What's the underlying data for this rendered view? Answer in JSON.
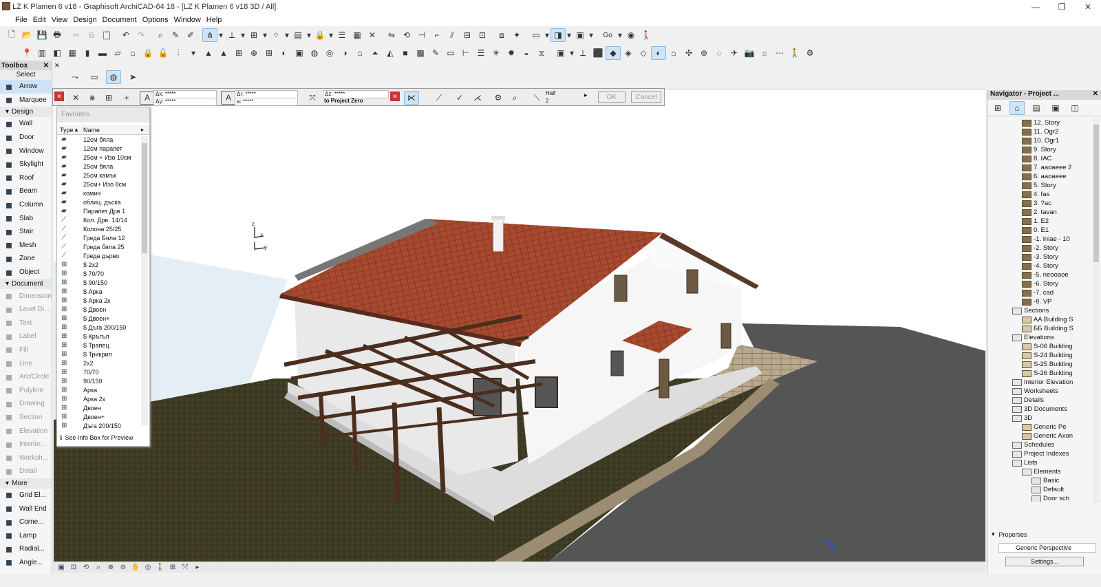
{
  "window": {
    "title": "LZ K Plamen 6 v18 - Graphisoft ArchiCAD-64 18 - [LZ K Plamen 6 v18 3D / All]",
    "controls": [
      "—",
      "❐",
      "✕"
    ]
  },
  "menu": [
    "File",
    "Edit",
    "View",
    "Design",
    "Document",
    "Options",
    "Window",
    "Help"
  ],
  "toolbox": {
    "title": "Toolbox",
    "select_label": "Select",
    "select_items": [
      {
        "label": "Arrow",
        "icon": "arrow-icon"
      },
      {
        "label": "Marquee",
        "icon": "marquee-icon"
      }
    ],
    "design_label": "Design",
    "design_items": [
      {
        "label": "Wall",
        "icon": "wall-icon"
      },
      {
        "label": "Door",
        "icon": "door-icon"
      },
      {
        "label": "Window",
        "icon": "window-icon"
      },
      {
        "label": "Skylight",
        "icon": "skylight-icon"
      },
      {
        "label": "Roof",
        "icon": "roof-icon"
      },
      {
        "label": "Beam",
        "icon": "beam-icon"
      },
      {
        "label": "Column",
        "icon": "column-icon"
      },
      {
        "label": "Slab",
        "icon": "slab-icon"
      },
      {
        "label": "Stair",
        "icon": "stair-icon"
      },
      {
        "label": "Mesh",
        "icon": "mesh-icon"
      },
      {
        "label": "Zone",
        "icon": "zone-icon"
      },
      {
        "label": "Object",
        "icon": "object-icon"
      }
    ],
    "document_label": "Document",
    "document_items": [
      {
        "label": "Dimension",
        "icon": "dimension-icon"
      },
      {
        "label": "Level Di...",
        "icon": "level-dimension-icon"
      },
      {
        "label": "Text",
        "icon": "text-icon"
      },
      {
        "label": "Label",
        "icon": "label-icon"
      },
      {
        "label": "Fill",
        "icon": "fill-icon"
      },
      {
        "label": "Line",
        "icon": "line-icon"
      },
      {
        "label": "Arc/Circle",
        "icon": "arc-circle-icon"
      },
      {
        "label": "Polyline",
        "icon": "polyline-icon"
      },
      {
        "label": "Drawing",
        "icon": "drawing-icon"
      },
      {
        "label": "Section",
        "icon": "section-icon"
      },
      {
        "label": "Elevation",
        "icon": "elevation-icon"
      },
      {
        "label": "Interior...",
        "icon": "interior-elevation-icon"
      },
      {
        "label": "Worksh...",
        "icon": "worksheet-icon"
      },
      {
        "label": "Detail",
        "icon": "detail-icon"
      }
    ],
    "more_label": "More",
    "more_items": [
      {
        "label": "Grid El...",
        "icon": "grid-element-icon"
      },
      {
        "label": "Wall End",
        "icon": "wall-end-icon"
      },
      {
        "label": "Corne...",
        "icon": "corner-window-icon"
      },
      {
        "label": "Lamp",
        "icon": "lamp-icon"
      },
      {
        "label": "Radial...",
        "icon": "radial-dimension-icon"
      },
      {
        "label": "Angle...",
        "icon": "angle-dimension-icon"
      }
    ]
  },
  "tracker": {
    "dx": "Δx: *****",
    "dy": "Δy: *****",
    "dr": "Δr: *****",
    "da": "a: *****",
    "dz": "Δz: *****",
    "dz_ref": "to Project Zero",
    "half": "Half",
    "half_n": "2",
    "ok": "OK",
    "cancel": "Cancel"
  },
  "favorites": {
    "title": "Favorites",
    "col_type": "Type",
    "col_name": "Name",
    "items": [
      "12см бяла",
      "12см парапет",
      "25см + Изо 10см",
      "25см бяла",
      "25см камък",
      "25см+ Изо 8см",
      "комин",
      "облиц. дъска",
      "Парапет Дрв 1",
      "Кол. Дрв. 14/14",
      "Колона 25/25",
      "Греда Бяла 12",
      "Греда бяла 25",
      "Греда дърво",
      "$ 2x2",
      "$ 70/70",
      "$ 90/150",
      "$ Арка",
      "$ Арка 2х",
      "$ Двоен",
      "$ Двоен+",
      "$ Дъга 200/150",
      "$ Кръгъл",
      "$ Трапец",
      "$ Трикрил",
      "2x2",
      "70/70",
      "90/150",
      "Арка",
      "Арка 2х",
      "Двоен",
      "Двоен+",
      "Дъга 200/150"
    ],
    "footer": "See Info Box for Preview"
  },
  "viewport": {
    "axis_z": "z",
    "axis_x": "x",
    "axis_y": "y"
  },
  "navigator": {
    "title": "Navigator - Project ...",
    "stories": [
      "12. Story",
      "11. Ogr2",
      "10. Ogr1",
      "9. Story",
      "8. IAC",
      "7. aaoaeee 2",
      "6. aaoaeee",
      "5. Story",
      "4. fas",
      "3. ?ac",
      "2. tavan",
      "1. E2",
      "0. E1",
      "-1. iniae - 10",
      "-2. Story",
      "-3. Story",
      "-4. Story",
      "-5. neooaoe",
      "-6. Story",
      "-7. cad",
      "-8. VP"
    ],
    "sections_label": "Sections",
    "sections": [
      "AA Building S",
      "ББ Building S"
    ],
    "elevations_label": "Elevations",
    "elevations": [
      "S-06 Building",
      "S-24 Building",
      "S-25 Building",
      "S-26 Building"
    ],
    "interior_label": "Interior Elevation",
    "worksheets_label": "Worksheets",
    "details_label": "Details",
    "docs3d_label": "3D Documents",
    "label_3d": "3D",
    "generic_perspective": "Generic Pe",
    "generic_axon": "Generic Axon",
    "schedules_label": "Schedules",
    "project_indexes_label": "Project Indexes",
    "lists_label": "Lists",
    "elements_label": "Elements",
    "basic_label": "Basic",
    "default_label": "Default",
    "door_sch_label": "Door sch",
    "properties_label": "Properties",
    "properties_value": "Generic Perspective",
    "settings_label": "Settings..."
  },
  "colors": {
    "roof": "#a84a30",
    "walls": "#f2f2f2",
    "wood": "#4b2e1e",
    "ground": "#3c3a22",
    "road": "#555555",
    "selection": "#cde4f7"
  }
}
